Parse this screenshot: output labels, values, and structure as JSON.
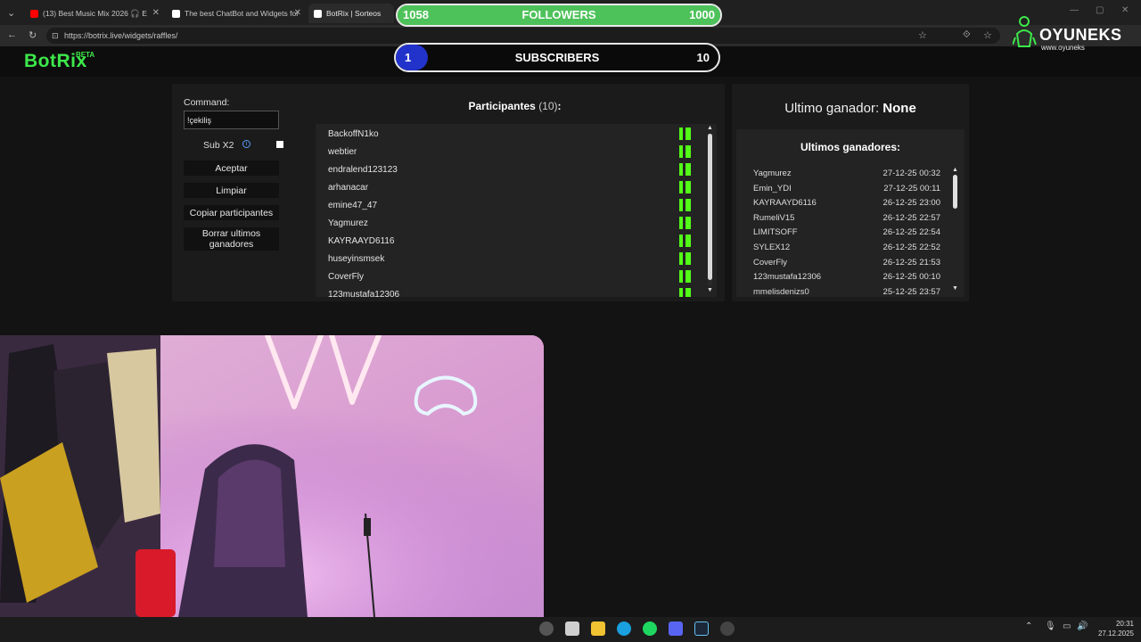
{
  "browser": {
    "tabs": [
      {
        "title": "(13) Best Music Mix 2026 🎧 E",
        "favicon_color": "#ff0000"
      },
      {
        "title": "The best ChatBot and Widgets for",
        "favicon_color": "#ffffff"
      },
      {
        "title": "BotRix | Sorteos",
        "favicon_color": "#ffffff"
      }
    ],
    "url": "https://botrix.live/widgets/raffles/"
  },
  "overlay": {
    "followers": {
      "current": "1058",
      "label": "FOLLOWERS",
      "goal": "1000",
      "progress": 1.0
    },
    "subscribers": {
      "current": "1",
      "label": "SUBSCRIBERS",
      "goal": "10",
      "progress": 0.1
    },
    "brand": {
      "name": "OYUNEKS",
      "site": "www.oyuneks"
    }
  },
  "app": {
    "logo": "BotRix",
    "logo_badge": "BETA"
  },
  "raffle": {
    "command_label": "Command:",
    "command_value": "!çekiliş",
    "sub_label": "Sub X2",
    "sub_checked": false,
    "buttons": {
      "accept": "Aceptar",
      "clear": "Limpiar",
      "copy": "Copiar participantes",
      "delete": "Borrar ultimos ganadores"
    },
    "participants_title": "Participantes",
    "participants_count": "(10)",
    "participants_colon": ":",
    "participants": [
      "BackoffN1ko",
      "webtier",
      "endralend123123",
      "arhanacar",
      "emine47_47",
      "Yagmurez",
      "KAYRAAYD6116",
      "huseyinsmsek",
      "CoverFly",
      "123mustafa12306"
    ]
  },
  "winners": {
    "last_winner_label": "Ultimo ganador:",
    "last_winner_value": "None",
    "title": "Ultimos ganadores:",
    "rows": [
      {
        "name": "Yagmurez",
        "date": "27-12-25 00:32"
      },
      {
        "name": "Emin_YDI",
        "date": "27-12-25 00:11"
      },
      {
        "name": "KAYRAAYD6116",
        "date": "26-12-25 23:00"
      },
      {
        "name": "RumeliV15",
        "date": "26-12-25 22:57"
      },
      {
        "name": "LIMITSOFF",
        "date": "26-12-25 22:54"
      },
      {
        "name": "SYLEX12",
        "date": "26-12-25 22:52"
      },
      {
        "name": "CoverFly",
        "date": "26-12-25 21:53"
      },
      {
        "name": "123mustafa12306",
        "date": "26-12-25 00:10"
      },
      {
        "name": "mmelisdenizs0",
        "date": "25-12-25 23:57"
      }
    ]
  },
  "taskbar": {
    "time": "20:31",
    "date": "27.12.2025"
  },
  "colors": {
    "accent_green": "#3de84a",
    "kick_green": "#53fc18",
    "subs_blue": "#2233cc"
  }
}
